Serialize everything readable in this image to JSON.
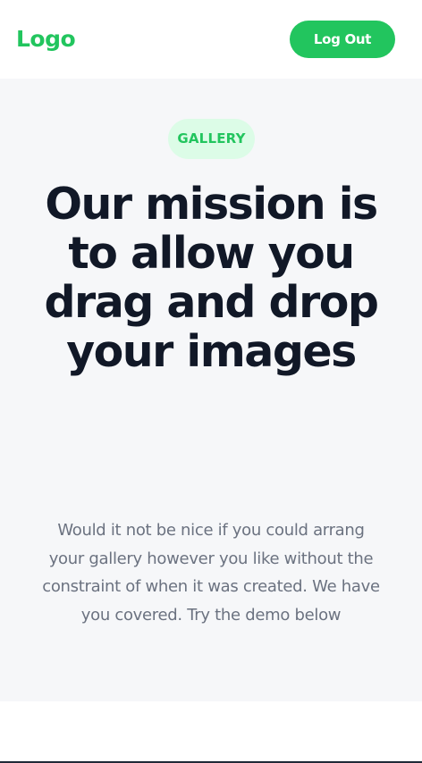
{
  "header": {
    "logo": "Logo",
    "logout_label": "Log Out"
  },
  "hero": {
    "badge": "GALLERY",
    "headline": "Our mission is to allow you drag and drop your images",
    "description": "Would it not be nice if you could arrang your gallery however you like without the constraint of when it was created. We have you covered. Try the demo below"
  },
  "colors": {
    "accent": "#22c55e",
    "badge_bg": "#dcfce7",
    "hero_bg": "#f6f7f9",
    "headline": "#111827",
    "body_text": "#6b7280"
  }
}
